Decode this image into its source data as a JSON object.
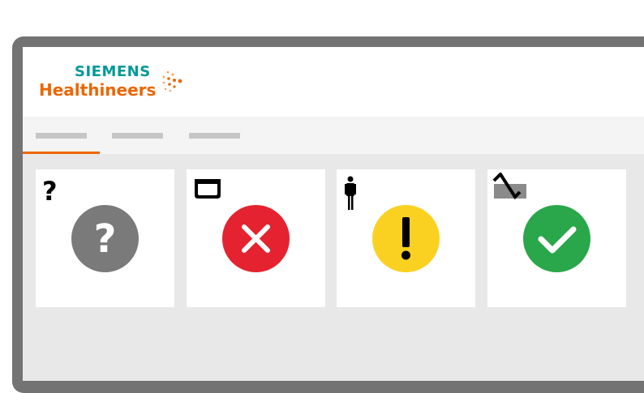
{
  "brand": {
    "line1": "SIEMENS",
    "line2": "Healthineers",
    "colors": {
      "teal": "#009999",
      "orange": "#ec6602"
    }
  },
  "tabs": {
    "active_index": 0,
    "items": [
      {
        "label": ""
      },
      {
        "label": ""
      },
      {
        "label": ""
      }
    ]
  },
  "cards": [
    {
      "type_icon": "question-mark-icon",
      "status": "unknown",
      "status_icon": "question-icon",
      "color": "#7a7a7a"
    },
    {
      "type_icon": "monitor-icon",
      "status": "error",
      "status_icon": "x-icon",
      "color": "#e5222f"
    },
    {
      "type_icon": "person-icon",
      "status": "warning",
      "status_icon": "exclamation-icon",
      "color": "#fbd121"
    },
    {
      "type_icon": "signal-icon",
      "status": "ok",
      "status_icon": "checkmark-icon",
      "color": "#2aa74b"
    }
  ]
}
